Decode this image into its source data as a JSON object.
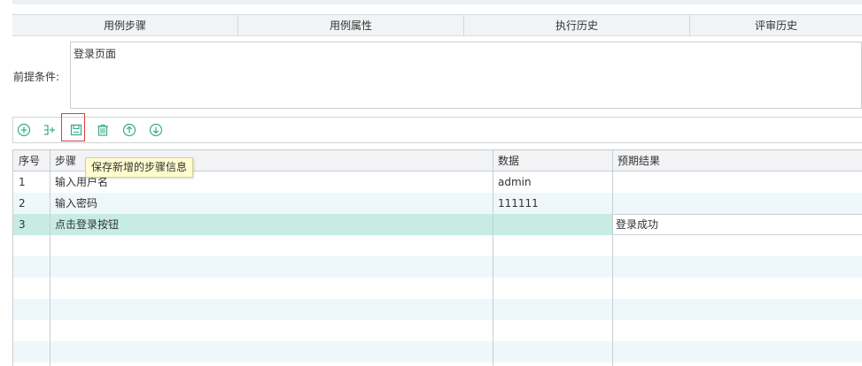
{
  "tabs": [
    {
      "label": "用例步骤"
    },
    {
      "label": "用例属性"
    },
    {
      "label": "执行历史"
    },
    {
      "label": "评审历史"
    }
  ],
  "precondition": {
    "label": "前提条件:",
    "value": "登录页面"
  },
  "toolbar": {
    "tooltip": "保存新增的步骤信息",
    "accent_color": "#3aaa8a",
    "highlight_color": "#e23b3b",
    "icons": [
      "add-circle-icon",
      "insert-step-icon",
      "save-icon",
      "trash-icon",
      "arrow-up-circle-icon",
      "arrow-down-circle-icon"
    ]
  },
  "grid": {
    "columns": [
      "序号",
      "步骤",
      "数据",
      "预期结果"
    ],
    "rows": [
      {
        "no": "1",
        "step": "输入用户名",
        "data": "admin",
        "expected": ""
      },
      {
        "no": "2",
        "step": "输入密码",
        "data": "111111",
        "expected": ""
      },
      {
        "no": "3",
        "step": "点击登录按钮",
        "data": "",
        "expected": "登录成功"
      }
    ],
    "selected_row_color": "#c6ece3"
  }
}
